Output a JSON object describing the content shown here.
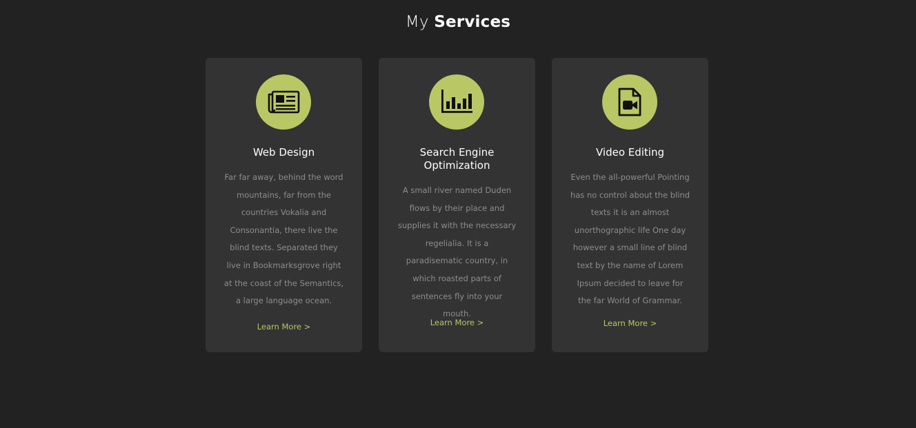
{
  "section": {
    "title_light": "My",
    "title_bold": "Services"
  },
  "colors": {
    "background": "#222222",
    "card": "#333333",
    "accent": "#bac765",
    "body_text": "#8d8d8d"
  },
  "cards": [
    {
      "icon": "newspaper-icon",
      "title": "Web Design",
      "text": "Far far away, behind the word mountains, far from the countries Vokalia and Consonantia, there live the blind texts. Separated they live in Bookmarksgrove right at the coast of the Semantics, a large language ocean.",
      "link": "Learn More >"
    },
    {
      "icon": "bar-chart-icon",
      "title": "Search Engine Optimization",
      "text": "A small river named Duden flows by their place and supplies it with the necessary regelialia. It is a paradisematic country, in which roasted parts of sentences fly into your mouth.",
      "link": "Learn More >"
    },
    {
      "icon": "video-file-icon",
      "title": "Video Editing",
      "text": "Even the all-powerful Pointing has no control about the blind texts it is an almost unorthographic life One day however a small line of blind text by the name of Lorem Ipsum decided to leave for the far World of Grammar.",
      "link": "Learn More >"
    }
  ]
}
